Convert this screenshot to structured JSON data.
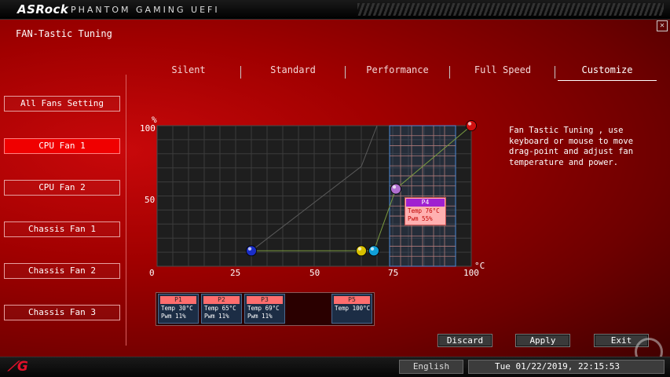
{
  "header": {
    "brand": "ASRock",
    "subtitle": "PHANTOM GAMING UEFI",
    "close_symbol": "✕"
  },
  "page": {
    "title": "FAN-Tastic Tuning"
  },
  "sidebar": {
    "items": [
      {
        "label": "All Fans Setting",
        "active": false
      },
      {
        "label": "CPU Fan 1",
        "active": true
      },
      {
        "label": "CPU Fan 2",
        "active": false
      },
      {
        "label": "Chassis Fan 1",
        "active": false
      },
      {
        "label": "Chassis Fan 2",
        "active": false
      },
      {
        "label": "Chassis Fan 3",
        "active": false
      }
    ]
  },
  "tabs": [
    {
      "label": "Silent",
      "active": false
    },
    {
      "label": "Standard",
      "active": false
    },
    {
      "label": "Performance",
      "active": false
    },
    {
      "label": "Full Speed",
      "active": false
    },
    {
      "label": "Customize",
      "active": true
    }
  ],
  "chart_data": {
    "type": "line",
    "y_unit": "%",
    "x_unit": "°C",
    "x_ticks": [
      "0",
      "25",
      "50",
      "75",
      "100"
    ],
    "y_ticks": [
      "100",
      "50",
      "0"
    ],
    "xlim": [
      0,
      100
    ],
    "ylim": [
      0,
      100
    ],
    "points": [
      {
        "name": "P1",
        "x": 30,
        "y": 11,
        "color": "#1a2ec8"
      },
      {
        "name": "P2",
        "x": 65,
        "y": 11,
        "color": "#d8c000"
      },
      {
        "name": "P3",
        "x": 69,
        "y": 11,
        "color": "#10a0d8"
      },
      {
        "name": "P4",
        "x": 76,
        "y": 55,
        "color": "#b06fd0"
      },
      {
        "name": "P5",
        "x": 100,
        "y": 100,
        "color": "#d01010"
      }
    ],
    "reference_line": {
      "x": [
        30,
        65,
        70
      ],
      "y": [
        11,
        71,
        100
      ]
    }
  },
  "tooltip": {
    "title": "P4",
    "temp": "Temp 76°C",
    "pwm": "Pwm  55%"
  },
  "help_text": "Fan Tastic Tuning , use keyboard or mouse to move drag-point and adjust fan temperature and power.",
  "point_boxes": [
    {
      "name": "P1",
      "temp": "Temp 30°C",
      "pwm": "Pwm  11%"
    },
    {
      "name": "P2",
      "temp": "Temp 65°C",
      "pwm": "Pwm  11%"
    },
    {
      "name": "P3",
      "temp": "Temp 69°C",
      "pwm": "Pwm  11%"
    },
    {
      "name": "P5",
      "temp": "Temp 100°C",
      "pwm": ""
    }
  ],
  "actions": {
    "discard": "Discard",
    "apply": "Apply",
    "exit": "Exit"
  },
  "footer": {
    "language": "English",
    "datetime": "Tue 01/22/2019, 22:15:53"
  },
  "colors": {
    "accent": "#f00000",
    "point_box_header": "#ff6d6d",
    "selection": "#4a8ad8"
  }
}
